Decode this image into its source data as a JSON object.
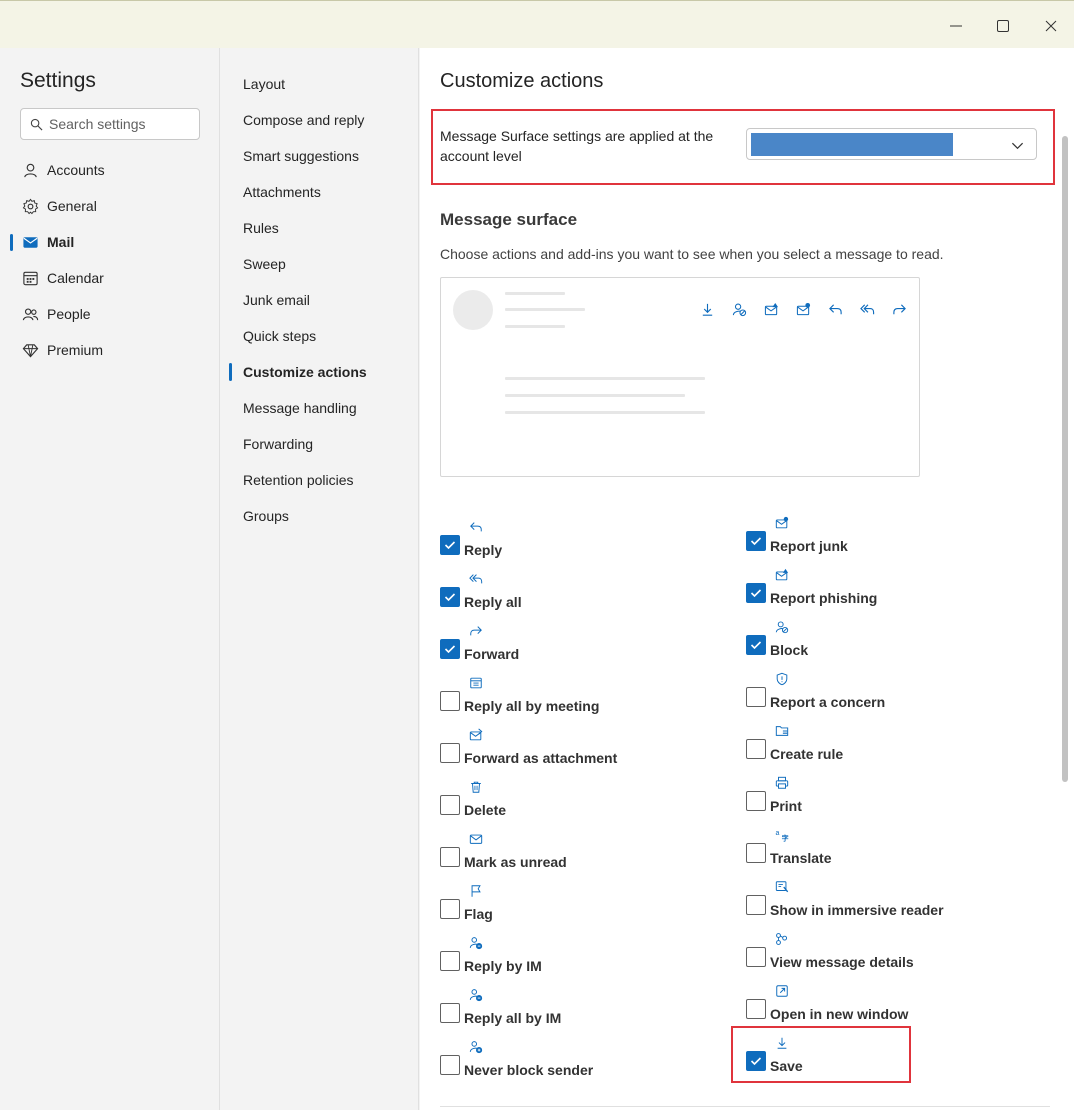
{
  "window": {
    "controls": [
      "minimize-icon",
      "maximize-icon",
      "close-icon"
    ]
  },
  "sidebar": {
    "title": "Settings",
    "search_placeholder": "Search settings",
    "items": [
      {
        "label": "Accounts",
        "icon": "person-icon"
      },
      {
        "label": "General",
        "icon": "gear-icon"
      },
      {
        "label": "Mail",
        "icon": "mail-icon",
        "active": true
      },
      {
        "label": "Calendar",
        "icon": "calendar-icon"
      },
      {
        "label": "People",
        "icon": "people-icon"
      },
      {
        "label": "Premium",
        "icon": "diamond-icon"
      }
    ]
  },
  "subnav": {
    "items": [
      {
        "label": "Layout"
      },
      {
        "label": "Compose and reply"
      },
      {
        "label": "Smart suggestions"
      },
      {
        "label": "Attachments"
      },
      {
        "label": "Rules"
      },
      {
        "label": "Sweep"
      },
      {
        "label": "Junk email"
      },
      {
        "label": "Quick steps"
      },
      {
        "label": "Customize actions",
        "active": true
      },
      {
        "label": "Message handling"
      },
      {
        "label": "Forwarding"
      },
      {
        "label": "Retention policies"
      },
      {
        "label": "Groups"
      }
    ]
  },
  "main": {
    "title": "Customize actions",
    "account_note": "Message Surface settings are applied at the account level",
    "section_title": "Message surface",
    "section_desc": "Choose actions and add-ins you want to see when you select a message to read.",
    "preview_icons": [
      "download-icon",
      "block-icon",
      "phishing-icon",
      "junk-icon",
      "reply-icon",
      "reply-all-icon",
      "forward-icon"
    ],
    "left_options": [
      {
        "label": "Reply",
        "checked": true,
        "icon": "reply-icon"
      },
      {
        "label": "Reply all",
        "checked": true,
        "icon": "reply-all-icon"
      },
      {
        "label": "Forward",
        "checked": true,
        "icon": "forward-icon"
      },
      {
        "label": "Reply all by meeting",
        "checked": false,
        "icon": "calendar-icon"
      },
      {
        "label": "Forward as attachment",
        "checked": false,
        "icon": "mail-attach-icon"
      },
      {
        "label": "Delete",
        "checked": false,
        "icon": "trash-icon"
      },
      {
        "label": "Mark as unread",
        "checked": false,
        "icon": "mail-icon"
      },
      {
        "label": "Flag",
        "checked": false,
        "icon": "flag-icon"
      },
      {
        "label": "Reply by IM",
        "checked": false,
        "icon": "person-chat-icon"
      },
      {
        "label": "Reply all by IM",
        "checked": false,
        "icon": "person-chat-icon"
      },
      {
        "label": "Never block sender",
        "checked": false,
        "icon": "person-add-icon"
      }
    ],
    "right_options": [
      {
        "label": "Report junk",
        "checked": true,
        "icon": "junk-icon"
      },
      {
        "label": "Report phishing",
        "checked": true,
        "icon": "phishing-icon"
      },
      {
        "label": "Block",
        "checked": true,
        "icon": "block-icon"
      },
      {
        "label": "Report a concern",
        "checked": false,
        "icon": "shield-icon"
      },
      {
        "label": "Create rule",
        "checked": false,
        "icon": "folder-rule-icon"
      },
      {
        "label": "Print",
        "checked": false,
        "icon": "printer-icon"
      },
      {
        "label": "Translate",
        "checked": false,
        "icon": "translate-icon"
      },
      {
        "label": "Show in immersive reader",
        "checked": false,
        "icon": "immersive-reader-icon"
      },
      {
        "label": "View message details",
        "checked": false,
        "icon": "details-icon"
      },
      {
        "label": "Open in new window",
        "checked": false,
        "icon": "open-window-icon"
      },
      {
        "label": "Save",
        "checked": true,
        "icon": "download-icon"
      }
    ]
  },
  "colors": {
    "accent": "#0f6cbd",
    "highlight_box": "#e0343c",
    "account_fill": "#4a86c8"
  }
}
